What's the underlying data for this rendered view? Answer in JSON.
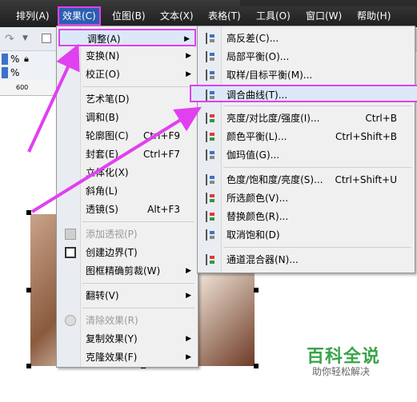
{
  "menubar": {
    "items": [
      "排列(A)",
      "效果(C)",
      "位图(B)",
      "文本(X)",
      "表格(T)",
      "工具(O)",
      "窗口(W)",
      "帮助(H)"
    ],
    "active_index": 1
  },
  "toolbar": {
    "pct1": "%",
    "pct2": "%",
    "ruler_mark": "600"
  },
  "effects_menu": {
    "items": [
      {
        "label": "调整(A)",
        "has_submenu": true,
        "highlighted": true
      },
      {
        "label": "变换(N)",
        "has_submenu": true
      },
      {
        "label": "校正(O)",
        "has_submenu": true
      },
      {
        "label": "艺术笔(D)"
      },
      {
        "label": "调和(B)"
      },
      {
        "label": "轮廓图(C)",
        "shortcut": "Ctrl+F9"
      },
      {
        "label": "封套(E)",
        "shortcut": "Ctrl+F7"
      },
      {
        "label": "立体化(X)"
      },
      {
        "label": "斜角(L)"
      },
      {
        "label": "透镜(S)",
        "shortcut": "Alt+F3"
      },
      {
        "label": "添加透视(P)",
        "disabled": true
      },
      {
        "label": "创建边界(T)"
      },
      {
        "label": "图框精确剪裁(W)",
        "has_submenu": true
      },
      {
        "label": "翻转(V)",
        "has_submenu": true
      },
      {
        "label": "清除效果(R)",
        "disabled": true
      },
      {
        "label": "复制效果(Y)",
        "has_submenu": true
      },
      {
        "label": "克隆效果(F)",
        "has_submenu": true
      }
    ]
  },
  "adjust_submenu": {
    "items": [
      {
        "label": "高反差(C)..."
      },
      {
        "label": "局部平衡(O)..."
      },
      {
        "label": "取样/目标平衡(M)..."
      },
      {
        "label": "调合曲线(T)...",
        "highlighted": true
      },
      {
        "label": "亮度/对比度/强度(I)...",
        "shortcut": "Ctrl+B"
      },
      {
        "label": "颜色平衡(L)...",
        "shortcut": "Ctrl+Shift+B"
      },
      {
        "label": "伽玛值(G)..."
      },
      {
        "label": "色度/饱和度/亮度(S)...",
        "shortcut": "Ctrl+Shift+U"
      },
      {
        "label": "所选颜色(V)..."
      },
      {
        "label": "替换颜色(R)..."
      },
      {
        "label": "取消饱和(D)"
      },
      {
        "label": "通道混合器(N)..."
      }
    ]
  },
  "watermark": {
    "title": "百科全说",
    "subtitle": "助你轻松解决"
  },
  "colors": {
    "annotation": "#e040f0",
    "menu_highlight": "#cfe0f5",
    "watermark_green": "#3aa34a"
  }
}
